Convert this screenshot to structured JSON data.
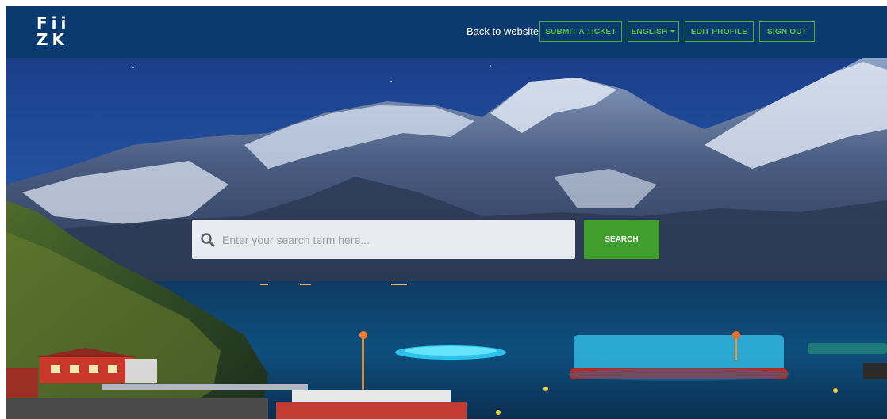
{
  "header": {
    "logo_line1": "Fii",
    "logo_line2": "ZK",
    "back_link": "Back to website",
    "submit_ticket": "SUBMIT A TICKET",
    "language": "ENGLISH",
    "edit_profile": "EDIT PROFILE",
    "sign_out": "SIGN OUT"
  },
  "search": {
    "placeholder": "Enter your search term here...",
    "button_label": "SEARCH",
    "icon": "search-icon"
  },
  "colors": {
    "header_bg": "#0b3b6e",
    "accent_green": "#3f9e2e"
  }
}
